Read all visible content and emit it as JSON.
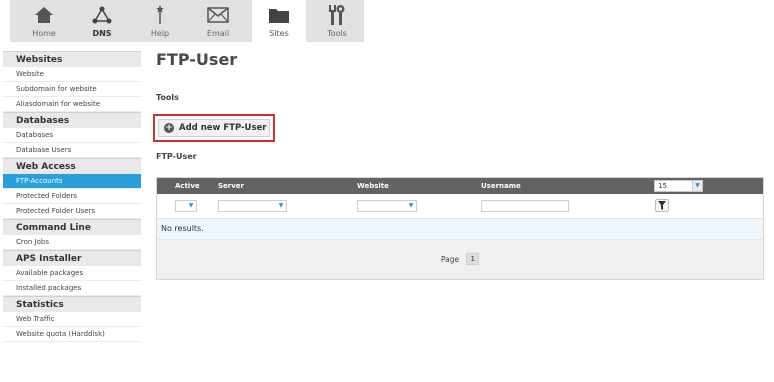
{
  "topnav": {
    "tabs": [
      {
        "label": "Home",
        "icon": "home-icon"
      },
      {
        "label": "DNS",
        "icon": "dns-icon"
      },
      {
        "label": "Help",
        "icon": "help-icon"
      },
      {
        "label": "Email",
        "icon": "email-icon"
      },
      {
        "label": "Sites",
        "icon": "sites-folder-icon",
        "active": true
      },
      {
        "label": "Tools",
        "icon": "tools-icon"
      }
    ]
  },
  "sidebar": {
    "sections": [
      {
        "title": "Websites",
        "items": [
          "Website",
          "Subdomain for website",
          "Aliasdomain for website"
        ]
      },
      {
        "title": "Databases",
        "items": [
          "Databases",
          "Database Users"
        ]
      },
      {
        "title": "Web Access",
        "items": [
          "FTP-Accounts",
          "Protected Folders",
          "Protected Folder Users"
        ]
      },
      {
        "title": "Command Line",
        "items": [
          "Cron Jobs"
        ]
      },
      {
        "title": "APS Installer",
        "items": [
          "Available packages",
          "Installed packages"
        ]
      },
      {
        "title": "Statistics",
        "items": [
          "Web Traffic",
          "Website quota (Harddisk)"
        ]
      }
    ],
    "active_item": "FTP-Accounts"
  },
  "main": {
    "title": "FTP-User",
    "tools_label": "Tools",
    "add_button_label": "Add new FTP-User",
    "list_label": "FTP-User"
  },
  "table": {
    "columns": [
      "Active",
      "Server",
      "Website",
      "Username"
    ],
    "page_size": "15",
    "empty_text": "No results.",
    "page_label": "Page",
    "current_page": "1"
  },
  "colors": {
    "accent": "#2a9fdb",
    "header_bg": "#626262",
    "highlight_border": "#d23030"
  }
}
